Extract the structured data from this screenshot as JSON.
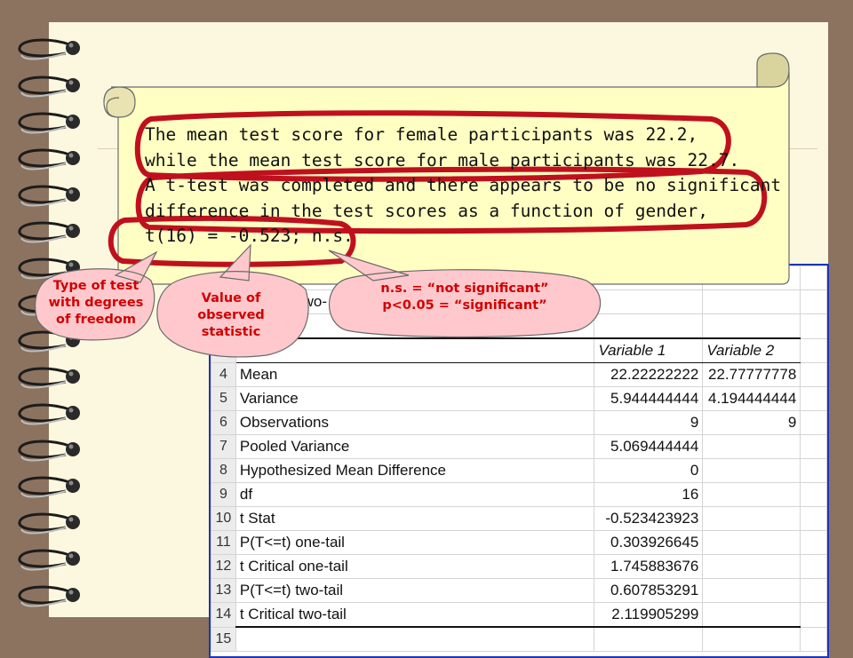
{
  "statement": {
    "lines": [
      "The mean test score for female participants was 22.2,",
      "while the mean test score for male participants was 22.7.",
      "A t-test was completed and there appears to be no significant",
      "difference in the test scores as a function of gender,",
      "t(16) = -0.523; n.s."
    ]
  },
  "callouts": {
    "test_type": [
      "Type of test",
      "with degrees",
      "of freedom"
    ],
    "observed_value": [
      "Value of",
      "observed",
      "statistic"
    ],
    "significance": [
      "n.s. = “not significant”",
      "p<0.05 = “significant”"
    ]
  },
  "spreadsheet": {
    "partial_title": "two-",
    "headers": [
      "",
      "Variable 1",
      "Variable 2"
    ],
    "rows": [
      {
        "num": "4",
        "label": "Mean",
        "v1": "22.22222222",
        "v2": "22.77777778"
      },
      {
        "num": "5",
        "label": "Variance",
        "v1": "5.944444444",
        "v2": "4.194444444"
      },
      {
        "num": "6",
        "label": "Observations",
        "v1": "9",
        "v2": "9"
      },
      {
        "num": "7",
        "label": "Pooled Variance",
        "v1": "5.069444444",
        "v2": ""
      },
      {
        "num": "8",
        "label": "Hypothesized Mean Difference",
        "v1": "0",
        "v2": ""
      },
      {
        "num": "9",
        "label": "df",
        "v1": "16",
        "v2": ""
      },
      {
        "num": "10",
        "label": "t Stat",
        "v1": "-0.523423923",
        "v2": ""
      },
      {
        "num": "11",
        "label": "P(T<=t) one-tail",
        "v1": "0.303926645",
        "v2": ""
      },
      {
        "num": "12",
        "label": "t Critical one-tail",
        "v1": "1.745883676",
        "v2": ""
      },
      {
        "num": "13",
        "label": "P(T<=t) two-tail",
        "v1": "0.607853291",
        "v2": ""
      },
      {
        "num": "14",
        "label": "t Critical two-tail",
        "v1": "2.119905299",
        "v2": ""
      },
      {
        "num": "15",
        "label": "",
        "v1": "",
        "v2": ""
      }
    ]
  },
  "colors": {
    "background": "#8c735f",
    "paper": "#fcf8df",
    "scroll": "#ffffc4",
    "marker": "#c0101e",
    "callout_fill": "#ffc8cc",
    "callout_text": "#d10000",
    "sheet_border": "#1c34b8"
  }
}
